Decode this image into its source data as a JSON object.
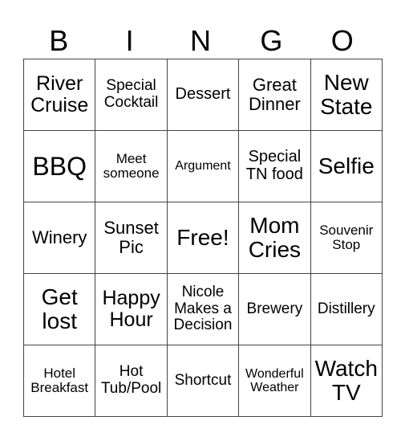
{
  "header": [
    "B",
    "I",
    "N",
    "G",
    "O"
  ],
  "cells": [
    [
      "River Cruise",
      "Special Cocktail",
      "Dessert",
      "Great Dinner",
      "New State"
    ],
    [
      "BBQ",
      "Meet someone",
      "Argument",
      "Special TN food",
      "Selfie"
    ],
    [
      "Winery",
      "Sunset Pic",
      "Free!",
      "Mom Cries",
      "Souvenir Stop"
    ],
    [
      "Get lost",
      "Happy Hour",
      "Nicole Makes a Decision",
      "Brewery",
      "Distillery"
    ],
    [
      "Hotel Breakfast",
      "Hot Tub/Pool",
      "Shortcut",
      "Wonderful Weather",
      "Watch TV"
    ]
  ]
}
